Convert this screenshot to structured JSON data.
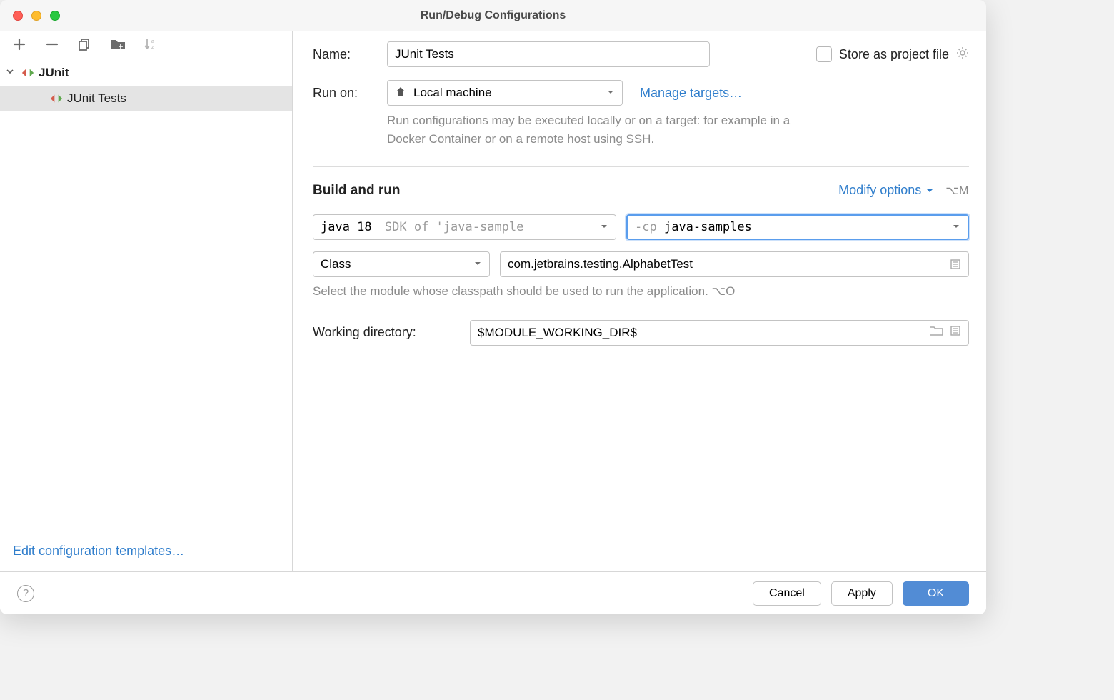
{
  "window": {
    "title": "Run/Debug Configurations"
  },
  "sidebar": {
    "tree": {
      "root": {
        "label": "JUnit"
      },
      "child": {
        "label": "JUnit Tests"
      }
    },
    "footer_link": "Edit configuration templates…"
  },
  "form": {
    "name_label": "Name:",
    "name_value": "JUnit Tests",
    "store_label": "Store as project file",
    "runon_label": "Run on:",
    "runon_value": "Local machine",
    "manage_link": "Manage targets…",
    "runon_help": "Run configurations may be executed locally or on a target: for example in a Docker Container or on a remote host using SSH.",
    "section_title": "Build and run",
    "modify_label": "Modify options",
    "modify_shortcut": "⌥M",
    "jdk_prefix": "java 18",
    "jdk_suffix": "SDK of 'java-sample",
    "cp_prefix": "-cp",
    "cp_value": "java-samples",
    "class_label": "Class",
    "class_value": "com.jetbrains.testing.AlphabetTest",
    "class_help": "Select the module whose classpath should be used to run the application. ⌥O",
    "wd_label": "Working directory:",
    "wd_value": "$MODULE_WORKING_DIR$"
  },
  "footer": {
    "cancel": "Cancel",
    "apply": "Apply",
    "ok": "OK"
  }
}
